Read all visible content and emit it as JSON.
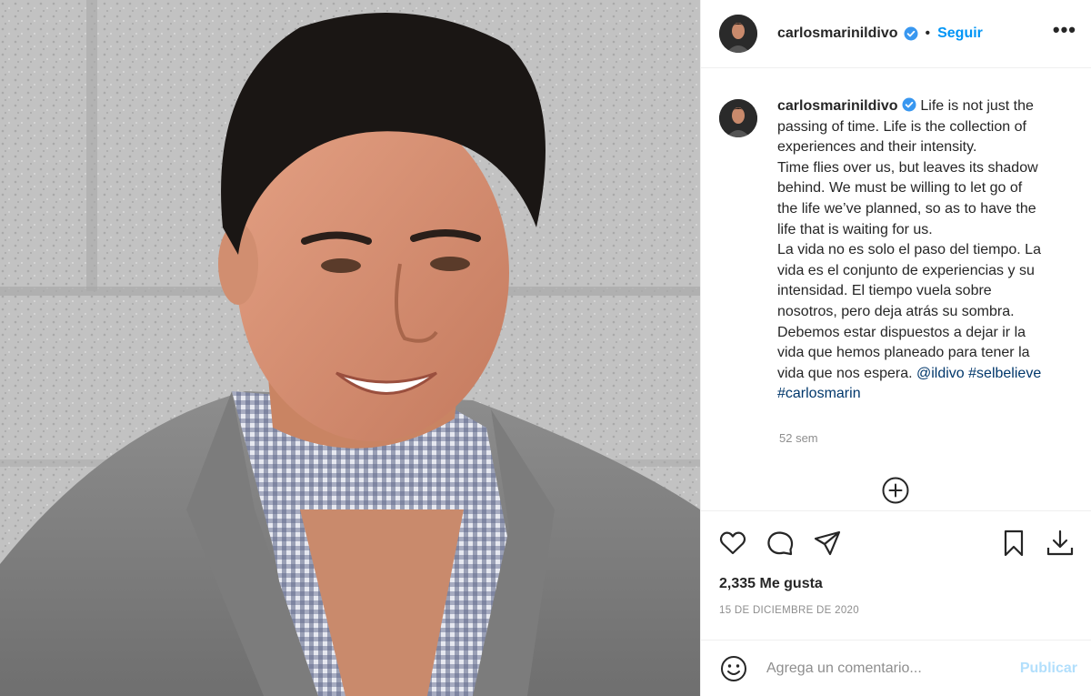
{
  "photo": {
    "icon": "portrait-photo"
  },
  "header": {
    "username": "carlosmarinildivo",
    "separator": "•",
    "follow_label": "Seguir",
    "more_label": "•••"
  },
  "caption": {
    "username": "carlosmarinildivo",
    "lines": [
      "Life is not just the",
      "passing of time. Life is the collection of",
      "experiences and their intensity.",
      "Time flies over us, but leaves its shadow",
      "behind. We must be willing to let go of",
      "the life we’ve planned, so as to have the",
      "life that is waiting for us.",
      "La vida no es solo el paso del tiempo. La",
      "vida es el conjunto de experiencias y su",
      "intensidad. El tiempo vuela sobre",
      "nosotros, pero deja atrás su sombra.",
      "Debemos estar dispuestos a dejar ir la",
      "vida que hemos planeado para tener la",
      "vida que nos espera."
    ],
    "mention": "@ildivo",
    "hashtag1": "#selbelieve",
    "hashtag2": "#carlosmarin",
    "time_ago": "52 sem"
  },
  "actions": {
    "like_icon": "heart-icon",
    "comment_icon": "comment-icon",
    "share_icon": "share-icon",
    "save_icon": "bookmark-icon",
    "download_icon": "download-icon"
  },
  "likes_text": "2,335 Me gusta",
  "date_text": "15 DE DICIEMBRE DE 2020",
  "comment": {
    "placeholder": "Agrega un comentario...",
    "publish_label": "Publicar"
  },
  "colors": {
    "link_blue": "#0095f6",
    "hashtag_blue": "#00376b",
    "publish_disabled": "#b2dffc",
    "muted": "#8e8e8e",
    "verified": "#3897f0"
  }
}
